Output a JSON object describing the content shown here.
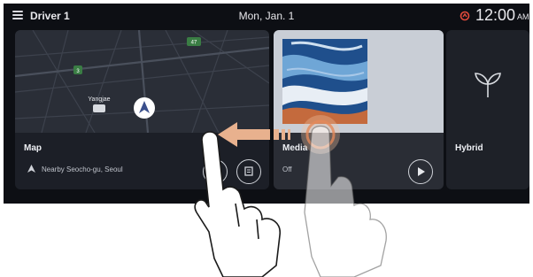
{
  "topbar": {
    "driver_label": "Driver 1",
    "date": "Mon, Jan. 1",
    "time": "12:00",
    "ampm": "AM"
  },
  "map_card": {
    "title": "Map",
    "location": "Nearby Seocho-gu, Seoul",
    "map_label_place": "Yangjae",
    "road_badge_1": "47",
    "road_badge_2": "3"
  },
  "media_card": {
    "title": "Media",
    "status": "Off"
  },
  "hybrid_card": {
    "title": "Hybrid"
  },
  "colors": {
    "screen_bg": "#0d0f14",
    "swipe_arrow": "#e8b18e",
    "touch_circle": "#e58a5a"
  },
  "icons": [
    "menu-icon",
    "weather-icon",
    "navigation-arrow-icon",
    "bookmark-icon",
    "play-icon",
    "leaf-icon",
    "swipe-left-arrow"
  ]
}
